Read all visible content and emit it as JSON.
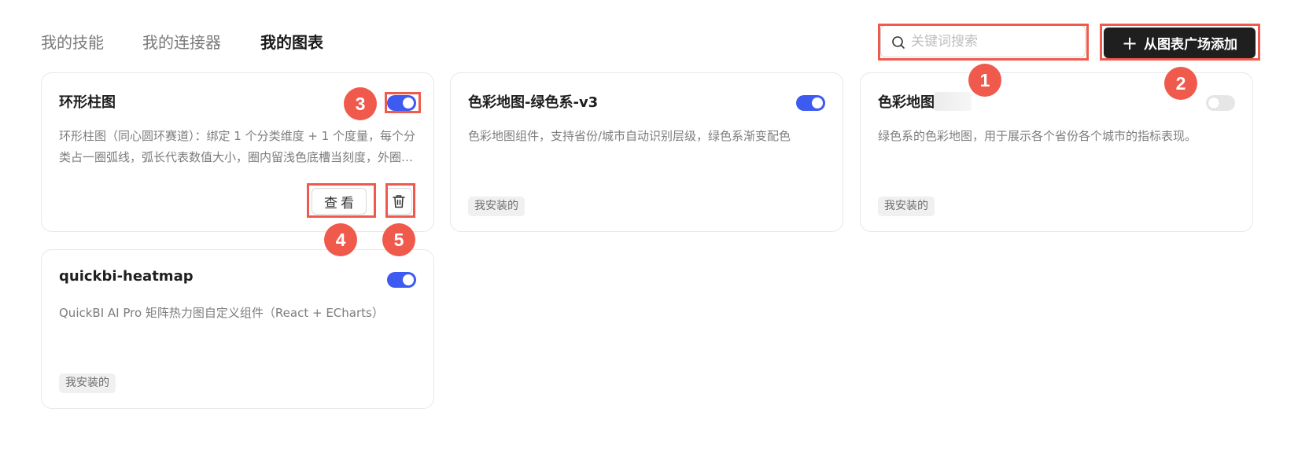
{
  "tabs": [
    {
      "label": "我的技能",
      "active": false
    },
    {
      "label": "我的连接器",
      "active": false
    },
    {
      "label": "我的图表",
      "active": true
    }
  ],
  "search": {
    "placeholder": "关键词搜索",
    "value": ""
  },
  "add_button": {
    "label": "从图表广场添加",
    "icon": "plus-icon"
  },
  "cards": [
    {
      "title": "环形柱图",
      "description": "环形柱图（同心圆环赛道）：绑定 1 个分类维度 + 1 个度量，每个分类占一圈弧线，弧长代表数值大小，圈内留浅色底槽当刻度，外圈逐步显示…",
      "enabled": true,
      "view_label": "查看"
    },
    {
      "title": "色彩地图-绿色系-v3",
      "description": "色彩地图组件，支持省份/城市自动识别层级，绿色系渐变配色",
      "enabled": true,
      "tag": "我安装的"
    },
    {
      "title": "色彩地图-",
      "description": "绿色系的色彩地图，用于展示各个省份各个城市的指标表现。",
      "enabled": false,
      "tag": "我安装的"
    },
    {
      "title": "quickbi-heatmap",
      "description": "QuickBI AI Pro 矩阵热力图自定义组件（React + ECharts）",
      "enabled": true,
      "tag": "我安装的"
    }
  ],
  "annotations": [
    "1",
    "2",
    "3",
    "4",
    "5"
  ],
  "colors": {
    "accent": "#3d5af1",
    "annotation": "#ef5a4c",
    "primary_button": "#1f1f1f"
  }
}
